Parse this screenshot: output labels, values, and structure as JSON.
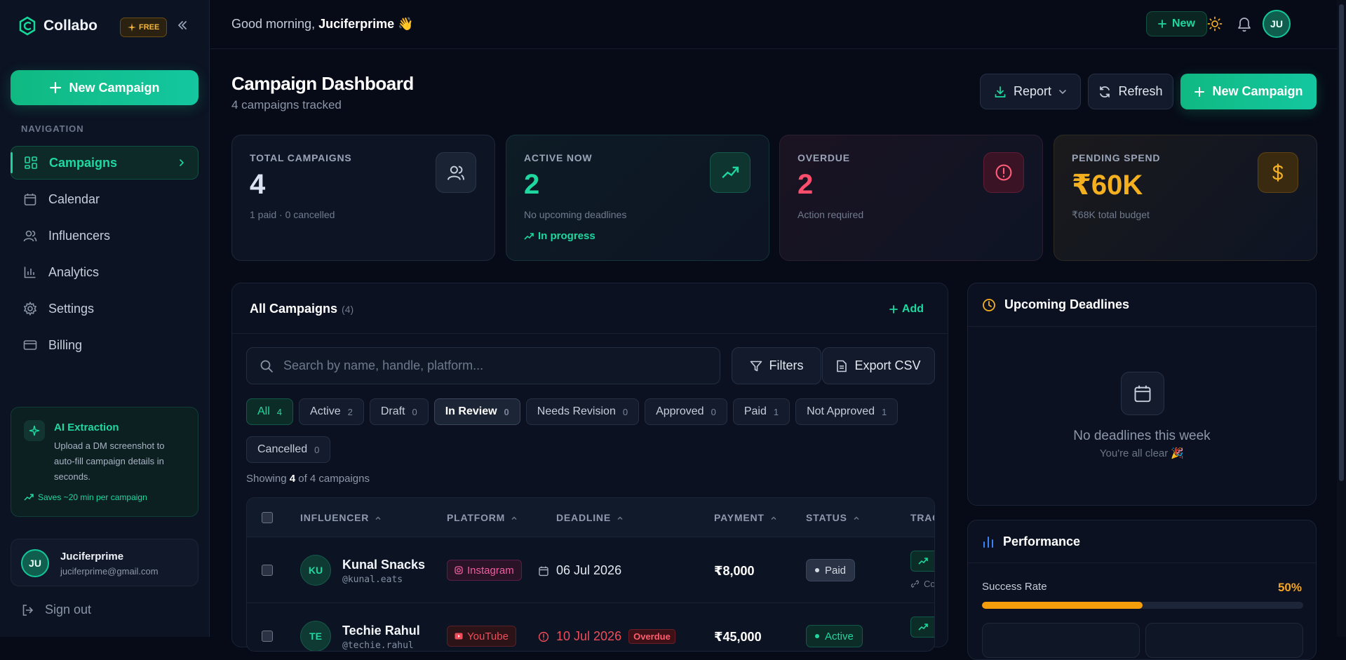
{
  "sidebar": {
    "logo": "Collabo",
    "plan_badge": "FREE",
    "new_campaign": "New Campaign",
    "nav_label": "NAVIGATION",
    "items": [
      {
        "label": "Campaigns",
        "icon": "grid-icon",
        "active": true
      },
      {
        "label": "Calendar",
        "icon": "calendar-icon"
      },
      {
        "label": "Influencers",
        "icon": "users-icon"
      },
      {
        "label": "Analytics",
        "icon": "chart-icon"
      },
      {
        "label": "Settings",
        "icon": "gear-icon"
      },
      {
        "label": "Billing",
        "icon": "card-icon"
      }
    ],
    "ai": {
      "title": "AI Extraction",
      "desc": "Upload a DM screenshot to auto-fill campaign details in seconds.",
      "saves": "Saves ~20 min per campaign"
    },
    "user": {
      "initials": "JU",
      "name": "Juciferprime",
      "email": "juciferprime@gmail.com"
    },
    "signout": "Sign out"
  },
  "topbar": {
    "greeting": "Good morning, ",
    "user": "Juciferprime",
    "wave": "👋",
    "new": "New",
    "avatar": "JU"
  },
  "header": {
    "title": "Campaign Dashboard",
    "subtitle": "4 campaigns tracked",
    "report": "Report",
    "refresh": "Refresh",
    "new_campaign": "New Campaign"
  },
  "stats": [
    {
      "label": "TOTAL CAMPAIGNS",
      "value": "4",
      "note": "1 paid · 0 cancelled",
      "color": "#dbe2f0"
    },
    {
      "label": "ACTIVE NOW",
      "value": "2",
      "note": "No upcoming deadlines",
      "extra": "In progress",
      "color": "#1fd8a0"
    },
    {
      "label": "OVERDUE",
      "value": "2",
      "note": "Action required",
      "color": "#ff4d6d"
    },
    {
      "label": "PENDING SPEND",
      "value": "₹60K",
      "note": "₹68K total budget",
      "color": "#f5b020"
    }
  ],
  "campaigns": {
    "title": "All Campaigns",
    "count": "(4)",
    "add": "Add",
    "search_placeholder": "Search by name, handle, platform...",
    "filters": "Filters",
    "export": "Export CSV",
    "chips": [
      {
        "label": "All",
        "count": "4"
      },
      {
        "label": "Active",
        "count": "2"
      },
      {
        "label": "Draft",
        "count": "0"
      },
      {
        "label": "In Review",
        "count": "0"
      },
      {
        "label": "Needs Revision",
        "count": "0"
      },
      {
        "label": "Approved",
        "count": "0"
      },
      {
        "label": "Paid",
        "count": "1"
      },
      {
        "label": "Not Approved",
        "count": "1"
      },
      {
        "label": "Cancelled",
        "count": "0"
      }
    ],
    "showing_prefix": "Showing ",
    "showing_count": "4",
    "showing_suffix": " of 4 campaigns",
    "columns": [
      "INFLUENCER",
      "PLATFORM",
      "DEADLINE",
      "PAYMENT",
      "STATUS",
      "TRAC"
    ],
    "rows": [
      {
        "initials": "KU",
        "name": "Kunal Snacks",
        "handle": "@kunal.eats",
        "platform": "Instagram",
        "deadline": "06 Jul 2026",
        "payment": "₹8,000",
        "status": "Paid",
        "track_link": "Co"
      },
      {
        "initials": "TE",
        "name": "Techie Rahul",
        "handle": "@techie.rahul",
        "platform": "YouTube",
        "deadline": "10 Jul 2026",
        "overdue": "Overdue",
        "payment": "₹45,000",
        "status": "Active"
      }
    ]
  },
  "deadlines": {
    "title": "Upcoming Deadlines",
    "empty_title": "No deadlines this week",
    "empty_sub": "You're all clear 🎉"
  },
  "performance": {
    "title": "Performance",
    "success_label": "Success Rate",
    "success_value": "50%",
    "success_fraction": 0.5
  }
}
